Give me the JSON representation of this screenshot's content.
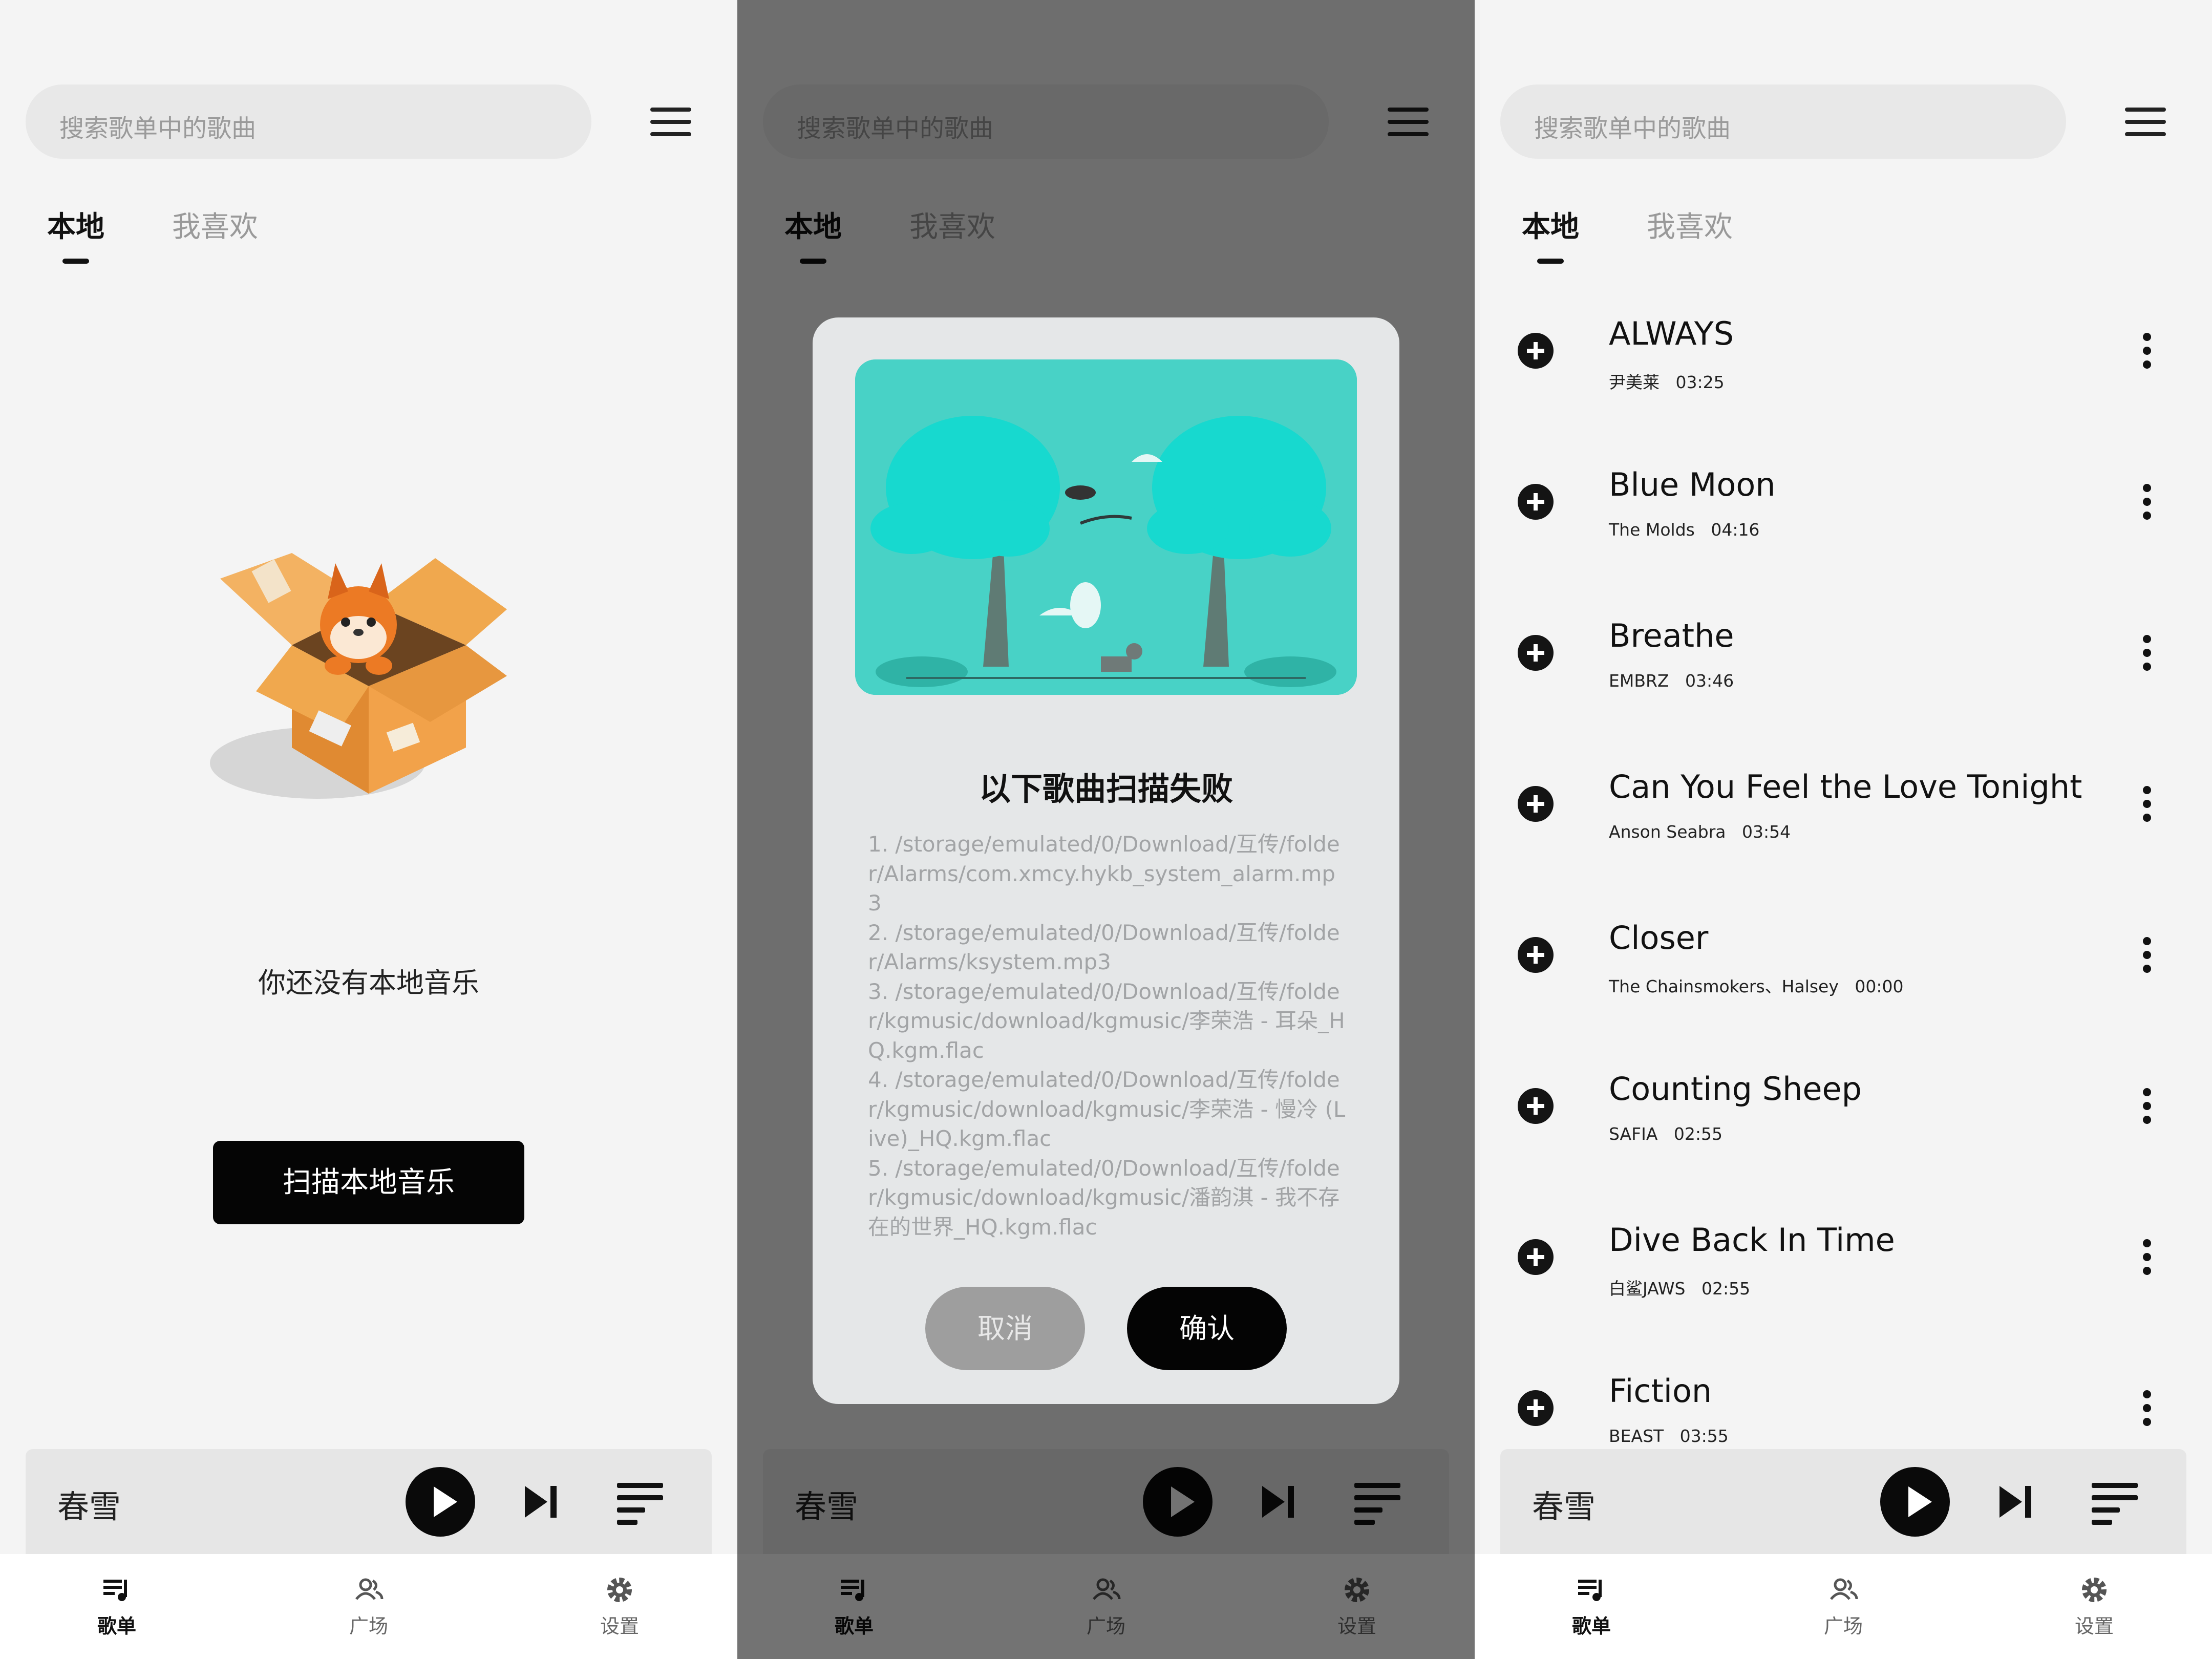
{
  "search": {
    "placeholder": "搜索歌单中的歌曲"
  },
  "tabs": {
    "local": "本地",
    "favorites": "我喜欢"
  },
  "empty": {
    "message": "你还没有本地音乐",
    "scan_button": "扫描本地音乐"
  },
  "player": {
    "song": "春雪"
  },
  "nav": {
    "playlist": "歌单",
    "plaza": "广场",
    "settings": "设置"
  },
  "dialog": {
    "title": "以下歌曲扫描失败",
    "body": "1. /storage/emulated/0/Download/互传/folder/Alarms/com.xmcy.hykb_system_alarm.mp3\n2. /storage/emulated/0/Download/互传/folder/Alarms/ksystem.mp3\n3. /storage/emulated/0/Download/互传/folder/kgmusic/download/kgmusic/李荣浩 - 耳朵_HQ.kgm.flac\n4. /storage/emulated/0/Download/互传/folder/kgmusic/download/kgmusic/李荣浩 - 慢冷 (Live)_HQ.kgm.flac\n5. /storage/emulated/0/Download/互传/folder/kgmusic/download/kgmusic/潘韵淇 - 我不存在的世界_HQ.kgm.flac",
    "cancel": "取消",
    "confirm": "确认"
  },
  "songs": [
    {
      "title": "ALWAYS",
      "artist": "尹美莱",
      "duration": "03:25"
    },
    {
      "title": "Blue Moon",
      "artist": "The Molds",
      "duration": "04:16"
    },
    {
      "title": "Breathe",
      "artist": "EMBRZ",
      "duration": "03:46"
    },
    {
      "title": "Can You Feel the Love Tonight",
      "artist": "Anson Seabra",
      "duration": "03:54"
    },
    {
      "title": "Closer",
      "artist": "The Chainsmokers、Halsey",
      "duration": "00:00"
    },
    {
      "title": "Counting Sheep",
      "artist": "SAFIA",
      "duration": "02:55"
    },
    {
      "title": "Dive Back In Time",
      "artist": "白鲨JAWS",
      "duration": "02:55"
    },
    {
      "title": "Fiction",
      "artist": "BEAST",
      "duration": "03:55"
    }
  ],
  "icons": {
    "menu": "hamburger-menu-icon",
    "play": "play-icon",
    "next": "skip-next-icon",
    "queue": "playlist-queue-icon",
    "add": "add-circle-icon",
    "more": "more-vertical-icon"
  },
  "colors": {
    "accent": "#000000",
    "illustration_bg": "#48d2c6",
    "dialog_bg": "#e5e7e8"
  }
}
